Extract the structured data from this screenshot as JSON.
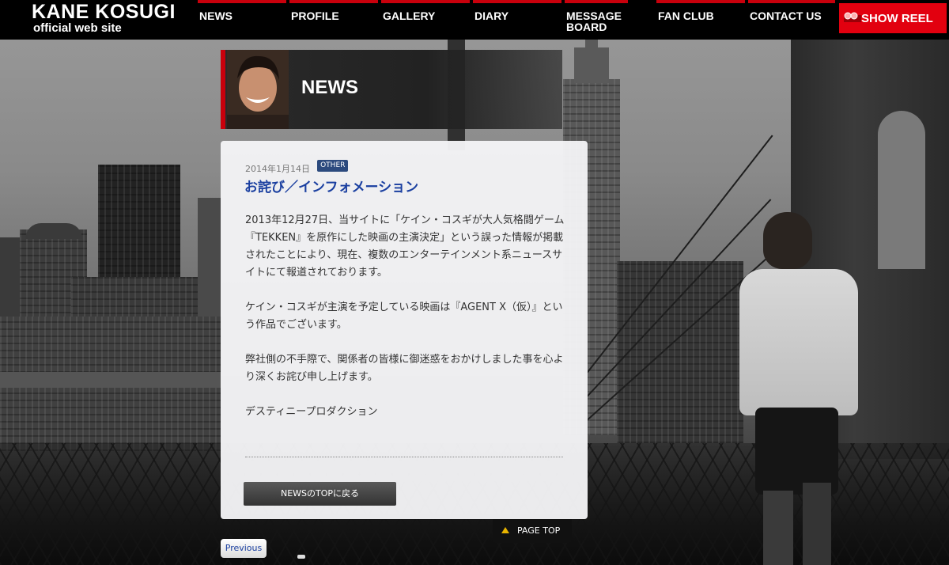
{
  "site": {
    "title": "KANE KOSUGI",
    "subtitle": "official web site"
  },
  "nav": {
    "items": [
      {
        "label": "NEWS"
      },
      {
        "label": "PROFILE"
      },
      {
        "label": "GALLERY"
      },
      {
        "label": "DIARY"
      },
      {
        "label": "MESSAGE BOARD"
      },
      {
        "label": "FAN CLUB"
      },
      {
        "label": "CONTACT US"
      }
    ],
    "show_reel_label": "SHOW REEL",
    "show_reel_icon": "film-reel-icon"
  },
  "section": {
    "title": "NEWS"
  },
  "article": {
    "date": "2014年1月14日",
    "category": "OTHER",
    "title": "お詫び／インフォメーション",
    "paragraphs": [
      "2013年12月27日、当サイトに「ケイン・コスギが大人気格闘ゲーム『TEKKEN』を原作にした映画の主演決定」という誤った情報が掲載されたことにより、現在、複数のエンターテインメント系ニュースサイトにて報道されております。",
      "ケイン・コスギが主演を予定している映画は『AGENT X（仮）』という作品でございます。",
      "弊社側の不手際で、関係者の皆様に御迷惑をおかけしました事を心より深くお詫び申し上げます。",
      "デスティニープロダクション"
    ],
    "back_label": "NEWSのTOPに戻る"
  },
  "footer": {
    "page_top_label": "PAGE TOP",
    "previous_label": "Previous"
  },
  "colors": {
    "accent_red": "#e2000f",
    "title_blue": "#1a3fa0",
    "badge_blue": "#2c4a7e",
    "arrow_yellow": "#e8b400"
  }
}
